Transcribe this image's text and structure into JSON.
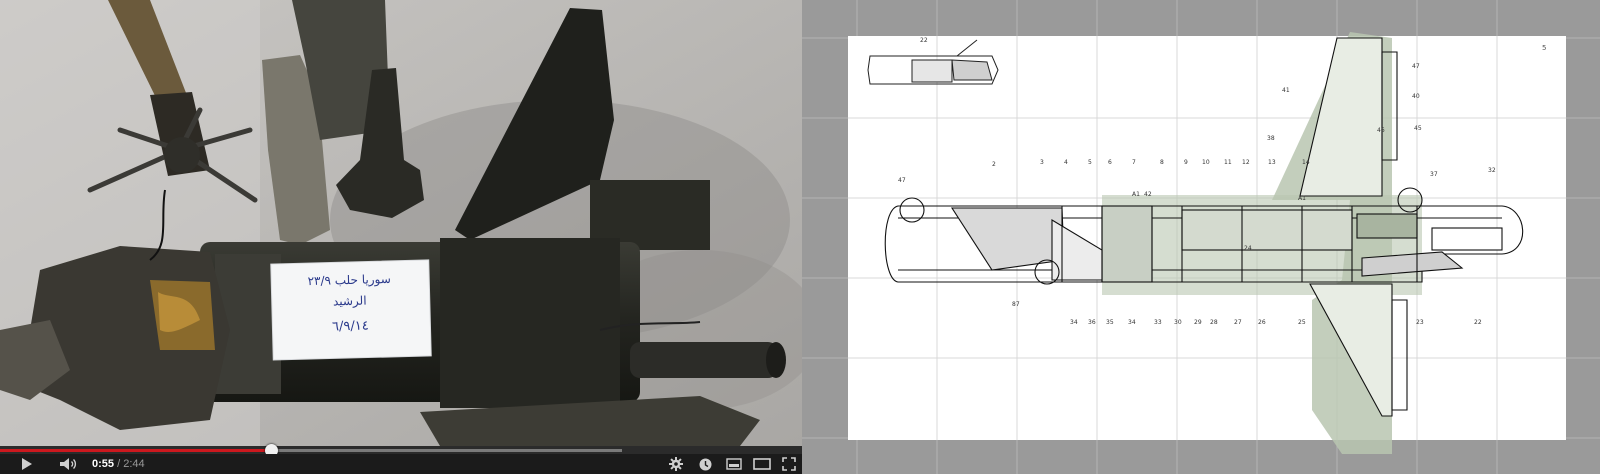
{
  "player": {
    "time_current": "0:55",
    "time_separator": " / ",
    "time_total": "2:44",
    "progress_played": 0.338,
    "progress_buffered": 0.776,
    "photo_note": {
      "line1": "سوريا حلب ٢٣/٩",
      "line2": "الرشيد",
      "line3": "٦/٩/١٤"
    },
    "icons": {
      "play": "play-icon",
      "volume": "volume-icon",
      "settings": "gear-icon",
      "watch_later": "clock-icon",
      "small_player": "small-player-icon",
      "large_player": "large-player-icon",
      "fullscreen": "fullscreen-icon"
    },
    "colors": {
      "played": "#cc181e",
      "buffered": "#7a7a7a",
      "bar_bg": "#1b1b1b"
    }
  },
  "viewer": {
    "colors": {
      "background": "#9a9a9a",
      "page": "#ffffff",
      "highlight": "#b9c6b0"
    },
    "page_number": "5",
    "callouts": [
      "22",
      "41",
      "47",
      "40",
      "45",
      "46",
      "38",
      "37",
      "32",
      "47",
      "2",
      "3",
      "4",
      "5",
      "6",
      "7",
      "8",
      "9",
      "10",
      "11",
      "12",
      "13",
      "14",
      "A1",
      "87",
      "34",
      "36",
      "35",
      "34",
      "33",
      "30",
      "29",
      "28",
      "27",
      "26",
      "25",
      "23",
      "22",
      "42",
      "24",
      "A1"
    ]
  }
}
